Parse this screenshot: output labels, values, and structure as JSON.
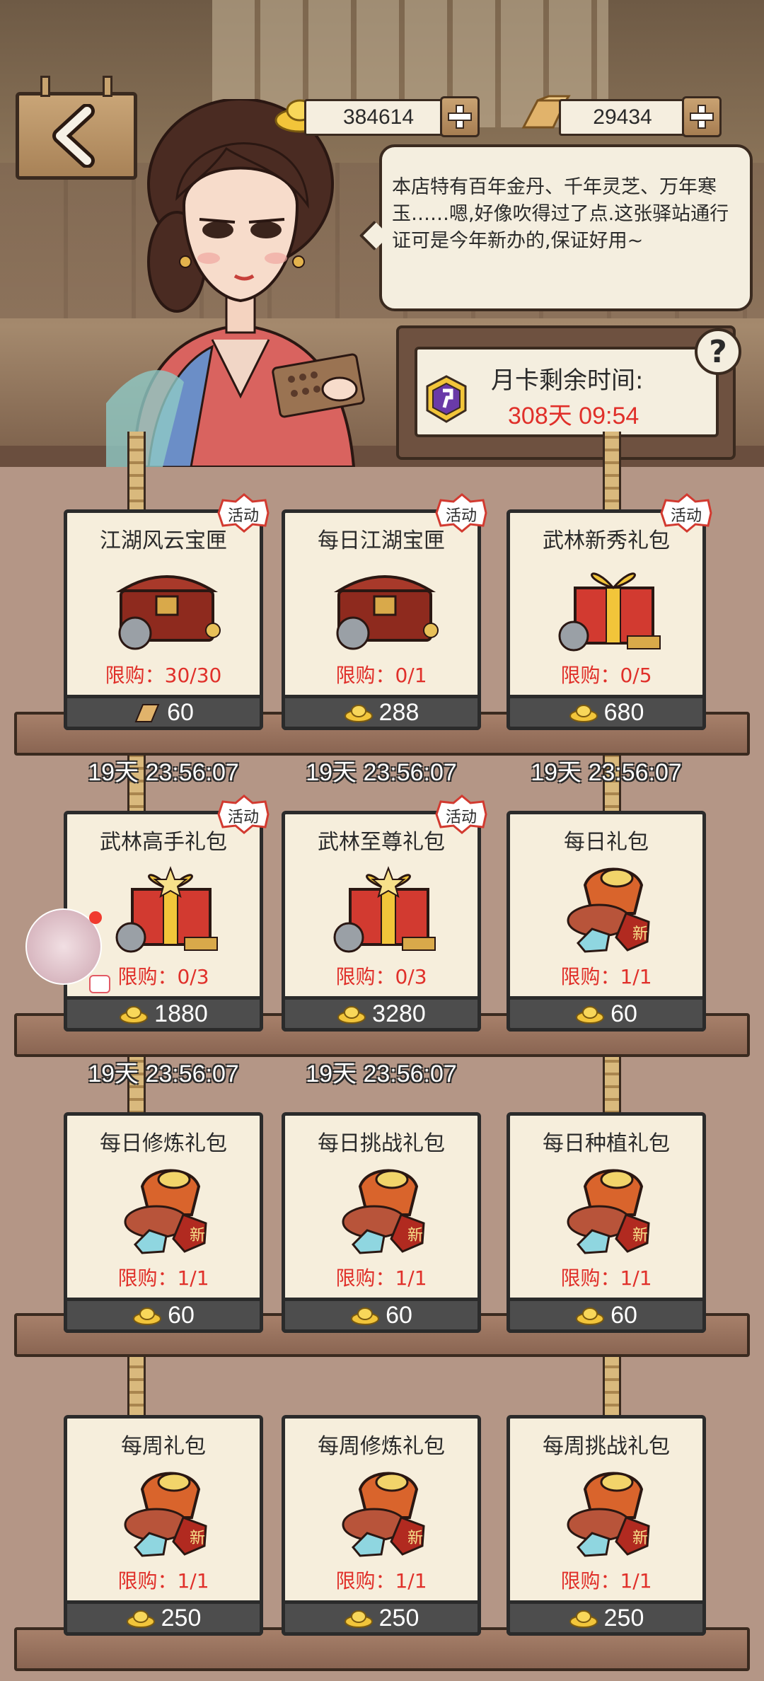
{
  "header": {
    "gold_amount": "384614",
    "bar_amount": "29434"
  },
  "speech": {
    "text": "本店特有百年金丹、千年灵芝、万年寒玉……嗯,好像吹得过了点.这张驿站通行证可是今年新办的,保证好用~"
  },
  "monthly_card": {
    "title": "月卡剩余时间:",
    "remaining": "308天 09:54"
  },
  "badge_text": "活动",
  "colors": {
    "limit_red": "#e0302a",
    "card_bg": "#f6eedc",
    "price_bar": "#4d4d4d",
    "plank": "#8a6552"
  },
  "packs": [
    {
      "name": "江湖风云宝匣",
      "limit": "限购：30/30",
      "currency": "silver-bar-icon",
      "price": "60",
      "badge": true,
      "timer": "19天 23:56:07",
      "art": "chest"
    },
    {
      "name": "每日江湖宝匣",
      "limit": "限购：0/1",
      "currency": "gold-ingot-icon",
      "price": "288",
      "badge": true,
      "timer": "19天 23:56:07",
      "art": "chest"
    },
    {
      "name": "武林新秀礼包",
      "limit": "限购：0/5",
      "currency": "gold-ingot-icon",
      "price": "680",
      "badge": true,
      "timer": "19天 23:56:07",
      "art": "gift"
    },
    {
      "name": "武林高手礼包",
      "limit": "限购：0/3",
      "currency": "gold-ingot-icon",
      "price": "1880",
      "badge": true,
      "timer": "19天 23:56:07",
      "art": "giftbig"
    },
    {
      "name": "武林至尊礼包",
      "limit": "限购：0/3",
      "currency": "gold-ingot-icon",
      "price": "3280",
      "badge": true,
      "timer": "19天 23:56:07",
      "art": "giftbig"
    },
    {
      "name": "每日礼包",
      "limit": "限购：1/1",
      "currency": "gold-ingot-icon",
      "price": "60",
      "badge": false,
      "timer": "",
      "art": "bag"
    },
    {
      "name": "每日修炼礼包",
      "limit": "限购：1/1",
      "currency": "gold-ingot-icon",
      "price": "60",
      "badge": false,
      "timer": "",
      "art": "bag"
    },
    {
      "name": "每日挑战礼包",
      "limit": "限购：1/1",
      "currency": "gold-ingot-icon",
      "price": "60",
      "badge": false,
      "timer": "",
      "art": "bag"
    },
    {
      "name": "每日种植礼包",
      "limit": "限购：1/1",
      "currency": "gold-ingot-icon",
      "price": "60",
      "badge": false,
      "timer": "",
      "art": "bag"
    },
    {
      "name": "每周礼包",
      "limit": "限购：1/1",
      "currency": "gold-ingot-icon",
      "price": "250",
      "badge": false,
      "timer": "",
      "art": "bag"
    },
    {
      "name": "每周修炼礼包",
      "limit": "限购：1/1",
      "currency": "gold-ingot-icon",
      "price": "250",
      "badge": false,
      "timer": "",
      "art": "bag"
    },
    {
      "name": "每周挑战礼包",
      "limit": "限购：1/1",
      "currency": "gold-ingot-icon",
      "price": "250",
      "badge": false,
      "timer": "",
      "art": "bag"
    }
  ],
  "icons": [
    "back-arrow-icon",
    "gold-ingot-icon",
    "silver-bar-icon",
    "plus-icon",
    "help-icon",
    "monthly-card-gem-icon",
    "new-badge-icon"
  ]
}
